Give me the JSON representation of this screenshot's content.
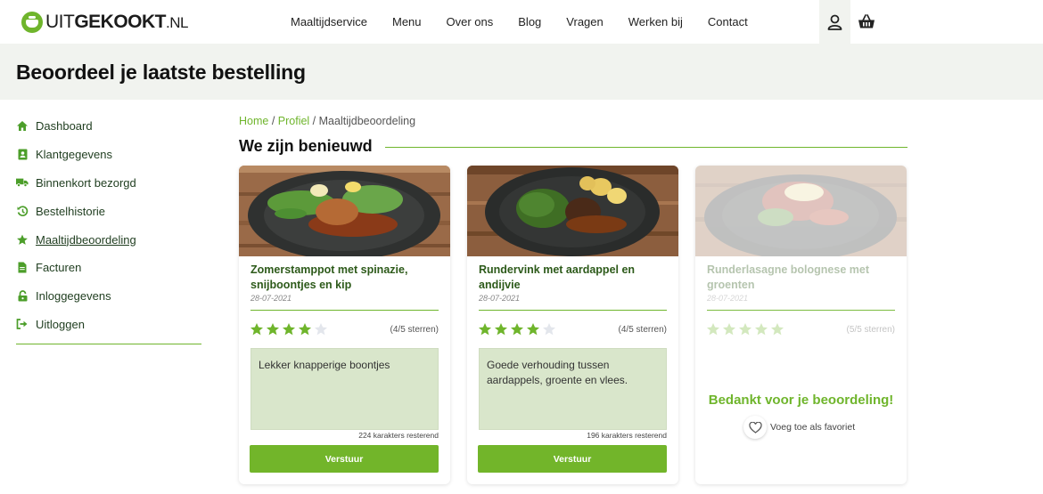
{
  "header": {
    "logo": {
      "part1": "UIT",
      "part2": "GEKOOKT",
      "part3": ".NL"
    },
    "nav": [
      "Maaltijdservice",
      "Menu",
      "Over ons",
      "Blog",
      "Vragen",
      "Werken bij",
      "Contact"
    ]
  },
  "page": {
    "title": "Beoordeel je laatste bestelling"
  },
  "sidebar": {
    "items": [
      {
        "label": "Dashboard",
        "icon": "home-icon"
      },
      {
        "label": "Klantgegevens",
        "icon": "contact-card-icon"
      },
      {
        "label": "Binnenkort bezorgd",
        "icon": "truck-icon"
      },
      {
        "label": "Bestelhistorie",
        "icon": "history-icon"
      },
      {
        "label": "Maaltijdbeoordeling",
        "icon": "star-icon",
        "active": true
      },
      {
        "label": "Facturen",
        "icon": "document-icon"
      },
      {
        "label": "Inloggegevens",
        "icon": "lock-icon"
      },
      {
        "label": "Uitloggen",
        "icon": "logout-icon"
      }
    ]
  },
  "breadcrumb": {
    "home": "Home",
    "sep1": " / ",
    "profile": "Profiel",
    "sep2": " / ",
    "current": "Maaltijdbeoordeling"
  },
  "section": {
    "heading": "We zijn benieuwd"
  },
  "colors": {
    "accent": "#6fb52c",
    "textarea": "#d9e6cb",
    "band": "#f1f3ef"
  },
  "cards": [
    {
      "name": "Zomerstamppot met spinazie, snijboontjes en kip",
      "date": "28-07-2021",
      "stars": 4,
      "rating_text": "(4/5 sterren)",
      "review": "Lekker knapperige boontjes",
      "chars": "224 karakters resterend",
      "button": "Verstuur"
    },
    {
      "name": "Rundervink met aardappel en andijvie",
      "date": "28-07-2021",
      "stars": 4,
      "rating_text": "(4/5 sterren)",
      "review": "Goede verhouding tussen aardappels, groente en vlees.",
      "chars": "196 karakters resterend",
      "button": "Verstuur"
    },
    {
      "name": "Runderlasagne bolognese met groenten",
      "date": "28-07-2021",
      "stars": 5,
      "rating_text": "(5/5 sterren)",
      "thanks": "Bedankt voor je beoordeling!",
      "favorite": "Voeg toe als favoriet"
    }
  ]
}
